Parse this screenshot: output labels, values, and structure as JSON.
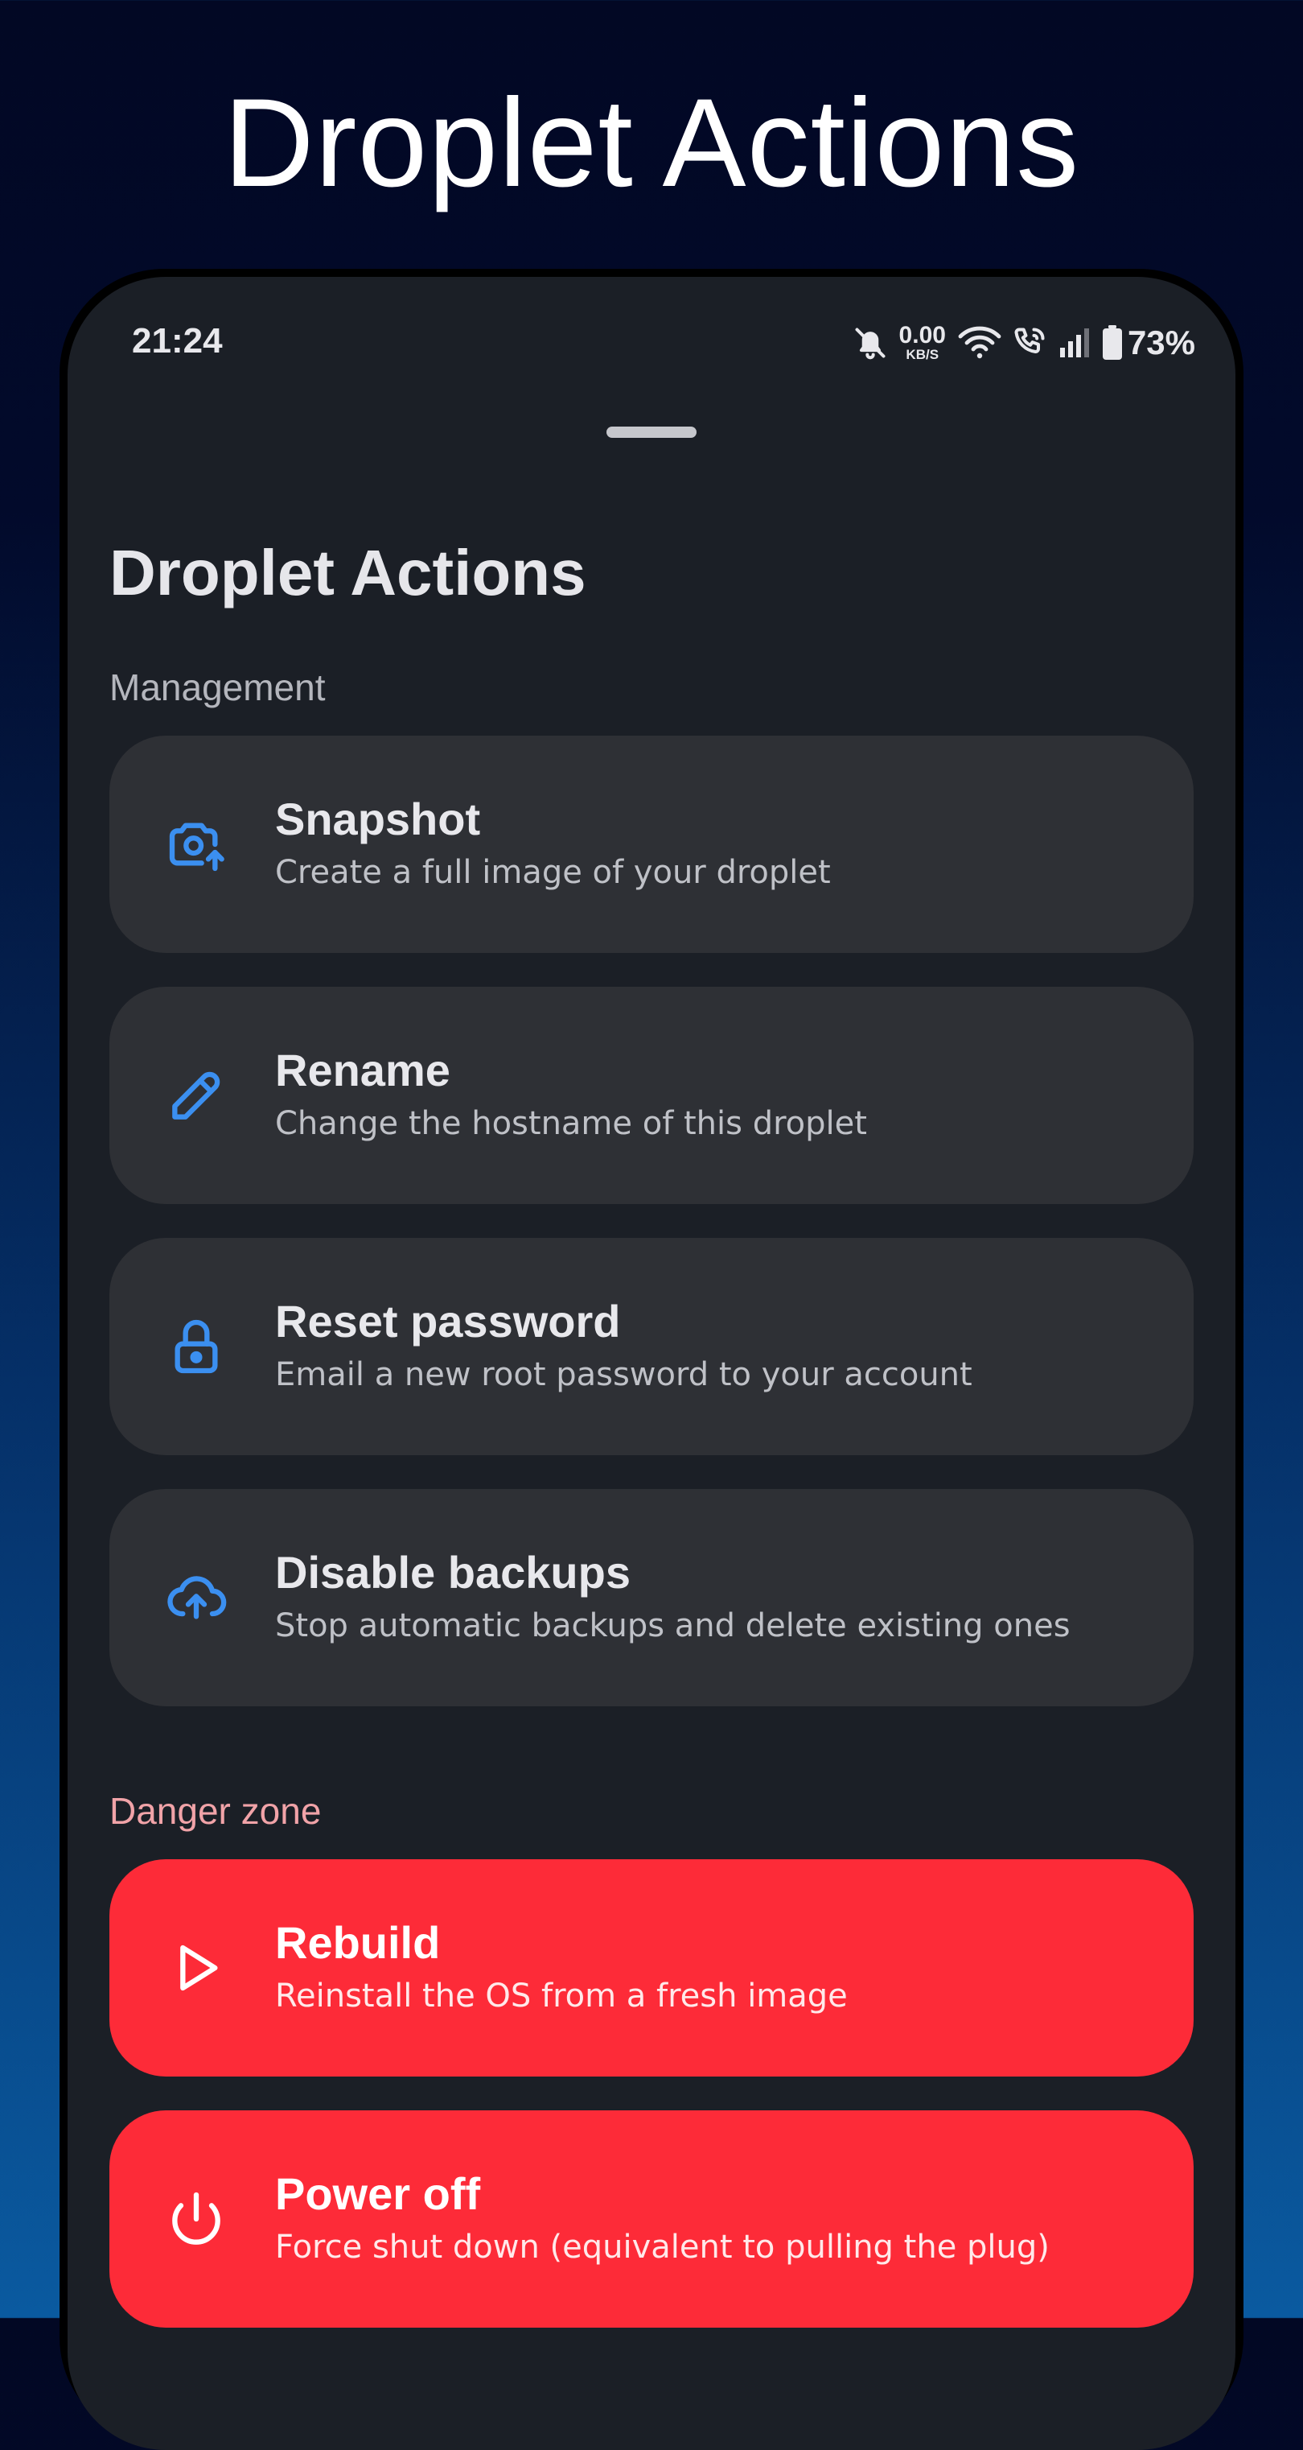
{
  "promo": {
    "title": "Droplet Actions"
  },
  "status_bar": {
    "time": "21:24",
    "net_speed_value": "0.00",
    "net_speed_unit": "KB/S",
    "battery_percent": "73%",
    "icons": [
      "bell-off-icon",
      "wifi-icon",
      "wifi-call-icon",
      "signal-icon",
      "battery-icon"
    ]
  },
  "sheet": {
    "title": "Droplet Actions",
    "management": {
      "label": "Management",
      "actions": [
        {
          "icon": "camera-upload-icon",
          "title": "Snapshot",
          "description": "Create a full image of your droplet"
        },
        {
          "icon": "pencil-icon",
          "title": "Rename",
          "description": "Change the hostname of this droplet"
        },
        {
          "icon": "lock-icon",
          "title": "Reset password",
          "description": "Email a new root password to your account"
        },
        {
          "icon": "cloud-upload-icon",
          "title": "Disable backups",
          "description": "Stop automatic backups and delete existing ones"
        }
      ]
    },
    "danger": {
      "label": "Danger zone",
      "actions": [
        {
          "icon": "play-icon",
          "title": "Rebuild",
          "description": "Reinstall the OS from a fresh image"
        },
        {
          "icon": "power-icon",
          "title": "Power off",
          "description": "Force shut down (equivalent to pulling the plug)"
        }
      ]
    }
  },
  "colors": {
    "accent_icon": "#3b8ff0",
    "card_background": "#2e3035",
    "danger_background": "#fd2b38",
    "sheet_background": "#1b1f26"
  }
}
